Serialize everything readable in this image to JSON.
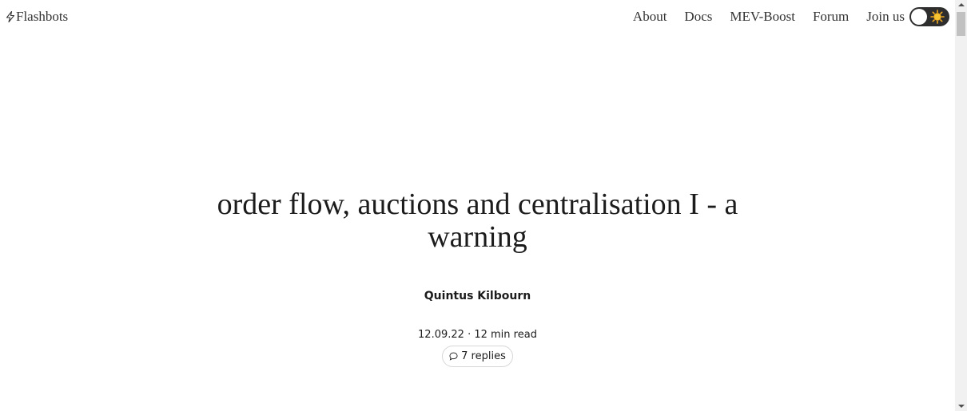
{
  "navbar": {
    "brand": "Flashbots",
    "brand_icon": "lightning-bolt-icon",
    "links": [
      "About",
      "Docs",
      "MEV-Boost",
      "Forum",
      "Join us"
    ],
    "theme_toggle": {
      "state": "light",
      "icon": "sun-icon"
    }
  },
  "post": {
    "title": "order flow, auctions and centralisation I - a warning",
    "author": "Quintus Kilbourn",
    "date": "12.09.22",
    "separator": "·",
    "read_time": "12 min read",
    "replies": "7 replies",
    "replies_icon": "comment-bubble-icon"
  }
}
